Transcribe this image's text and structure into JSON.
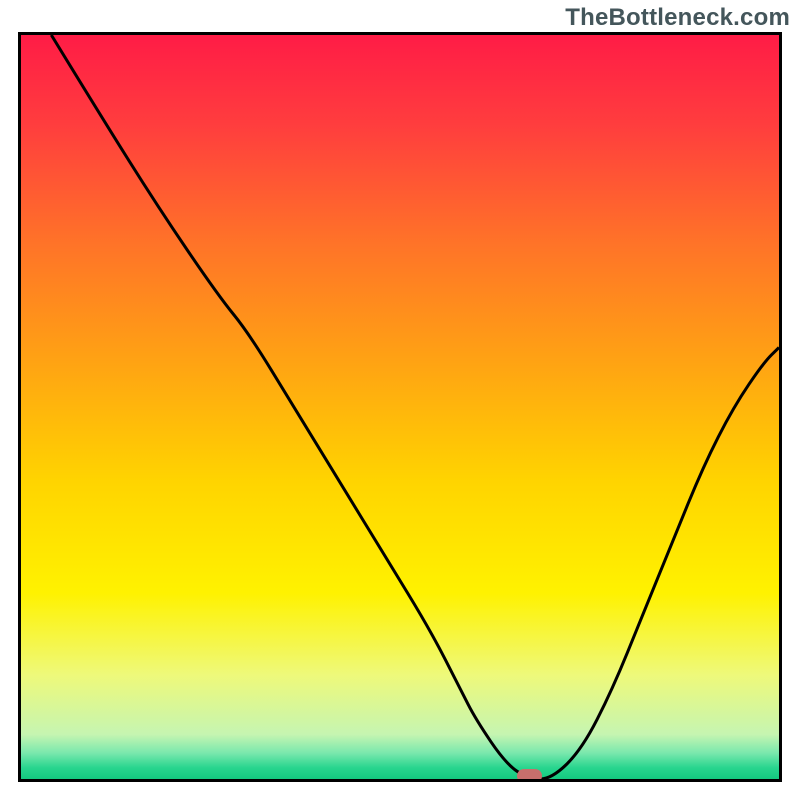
{
  "watermark": "TheBottleneck.com",
  "chart_data": {
    "type": "line",
    "title": "",
    "xlabel": "",
    "ylabel": "",
    "xlim": [
      0,
      100
    ],
    "ylim": [
      0,
      100
    ],
    "grid": false,
    "legend": false,
    "background_gradient_stops": [
      {
        "offset": 0.0,
        "color": "#ff1c46"
      },
      {
        "offset": 0.12,
        "color": "#ff3d3e"
      },
      {
        "offset": 0.28,
        "color": "#ff7328"
      },
      {
        "offset": 0.44,
        "color": "#ffa313"
      },
      {
        "offset": 0.6,
        "color": "#ffd400"
      },
      {
        "offset": 0.75,
        "color": "#fff200"
      },
      {
        "offset": 0.86,
        "color": "#eef97a"
      },
      {
        "offset": 0.94,
        "color": "#c6f5b1"
      },
      {
        "offset": 0.965,
        "color": "#7ae8ad"
      },
      {
        "offset": 0.985,
        "color": "#28d58e"
      },
      {
        "offset": 1.0,
        "color": "#14c97f"
      }
    ],
    "series": [
      {
        "name": "bottleneck-curve",
        "stroke": "#000000",
        "x": [
          4,
          10,
          18,
          26,
          30,
          36,
          42,
          48,
          54,
          58,
          60,
          64,
          67,
          70,
          74,
          78,
          82,
          86,
          90,
          94,
          98,
          100
        ],
        "values": [
          100,
          90,
          77,
          65,
          60,
          50,
          40,
          30,
          20,
          12,
          8,
          2,
          0,
          0,
          4,
          12,
          22,
          32,
          42,
          50,
          56,
          58
        ]
      }
    ],
    "marker": {
      "x": 67,
      "y": 0,
      "color": "#c76f6c"
    }
  }
}
